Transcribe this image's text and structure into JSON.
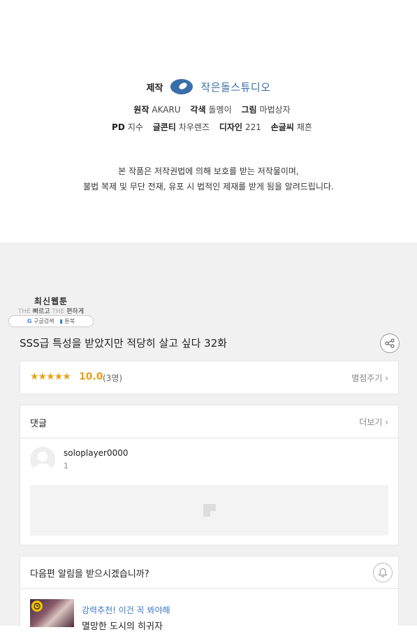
{
  "credits": {
    "studio_label": "제작",
    "studio_name": "작은돌스튜디오",
    "line1": [
      {
        "k": "원작",
        "v": "AKARU"
      },
      {
        "k": "각색",
        "v": "돌멩이"
      },
      {
        "k": "그림",
        "v": "마법상자"
      }
    ],
    "line2": [
      {
        "k": "PD",
        "v": "지수"
      },
      {
        "k": "글콘티",
        "v": "차우렌즈"
      },
      {
        "k": "디자인",
        "v": "221"
      },
      {
        "k": "손글씨",
        "v": "채흔"
      }
    ],
    "notice1": "본 작품은 저작권법에 의해 보호를 받는 저작물이며,",
    "notice2": "불법 복제 및 무단 전재, 유포 시 법적인 제재를 받게 됨을 알려드립니다."
  },
  "badge": {
    "title": "최신웹툰",
    "sub_a": "THE",
    "sub_b": "빠르고",
    "sub_c": "THE",
    "sub_d": "편하게",
    "search": "구글검색",
    "site": "툰북"
  },
  "episode": {
    "title": "SSS급 특성을 받았지만 적당히 살고 싶다 32화"
  },
  "rating": {
    "stars": "★★★★★",
    "score": "10.0",
    "count": "(3명)",
    "rate_link": "별점주기 ›"
  },
  "comments": {
    "title": "댓글",
    "more": "더보기 ›",
    "items": [
      {
        "user": "soloplayer0000",
        "text": "1"
      }
    ]
  },
  "notify": {
    "title": "다음편 알림을 받으시겠습니까?",
    "rec_tag": "강력추천! 이건 꼭 봐야해",
    "rec_title": "멸망한 도시의 히귀자"
  },
  "colors": {
    "accent": "#e8a01c",
    "link_blue": "#3a78c9",
    "studio_blue": "#3a6ea8",
    "bg_gray": "#f1f1f1"
  }
}
